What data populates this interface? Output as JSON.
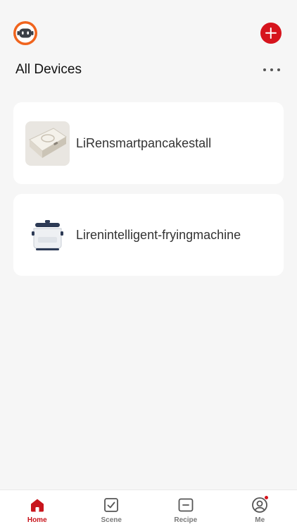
{
  "header": {
    "title": "All Devices",
    "logo_icon": "robot-logo-icon",
    "add_icon": "plus-circle-icon",
    "more_icon": "more-dots-icon"
  },
  "devices": [
    {
      "name": "LiRensmartpancakestall",
      "icon": "pancake-maker-image"
    },
    {
      "name": "Lirenintelligent-fryingmachine",
      "icon": "frying-machine-image"
    }
  ],
  "tabs": [
    {
      "label": "Home",
      "icon": "home-icon",
      "active": true
    },
    {
      "label": "Scene",
      "icon": "scene-check-icon",
      "active": false
    },
    {
      "label": "Recipe",
      "icon": "recipe-icon",
      "active": false
    },
    {
      "label": "Me",
      "icon": "profile-icon",
      "active": false,
      "badge": true
    }
  ],
  "colors": {
    "accent": "#d6141d",
    "background": "#f6f6f6",
    "card": "#ffffff",
    "tab_inactive": "#7a7a7a"
  }
}
